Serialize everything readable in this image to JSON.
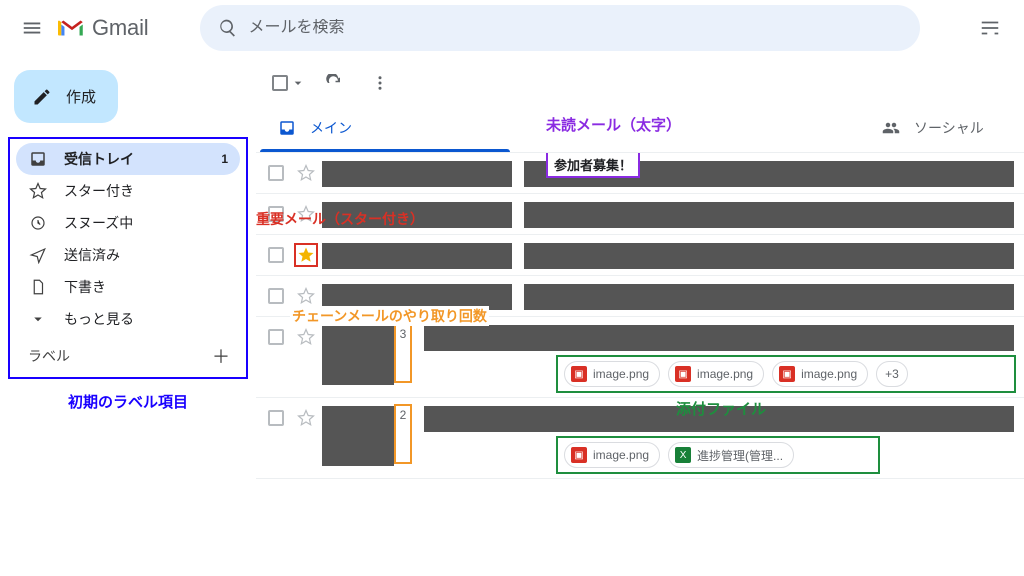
{
  "brand": "Gmail",
  "search": {
    "placeholder": "メールを検索"
  },
  "compose_label": "作成",
  "sidebar": {
    "items": [
      {
        "label": "受信トレイ",
        "count": "1"
      },
      {
        "label": "スター付き"
      },
      {
        "label": "スヌーズ中"
      },
      {
        "label": "送信済み"
      },
      {
        "label": "下書き"
      },
      {
        "label": "もっと見る"
      }
    ],
    "labels_header": "ラベル",
    "caption": "初期のラベル項目"
  },
  "tabs": {
    "main": "メイン",
    "social": "ソーシャル"
  },
  "annotations": {
    "unread": "未読メール（太字）",
    "star": "重要メール（スター付き）",
    "chain": "チェーンメールのやり取り回数",
    "attach": "添付ファイル"
  },
  "rows": {
    "r1_subject": "参加者募集！",
    "r5_thread": "3",
    "r6_thread": "2",
    "att_image": "image.png",
    "att_more": "+3",
    "att_sheet": "進捗管理(管理..."
  }
}
